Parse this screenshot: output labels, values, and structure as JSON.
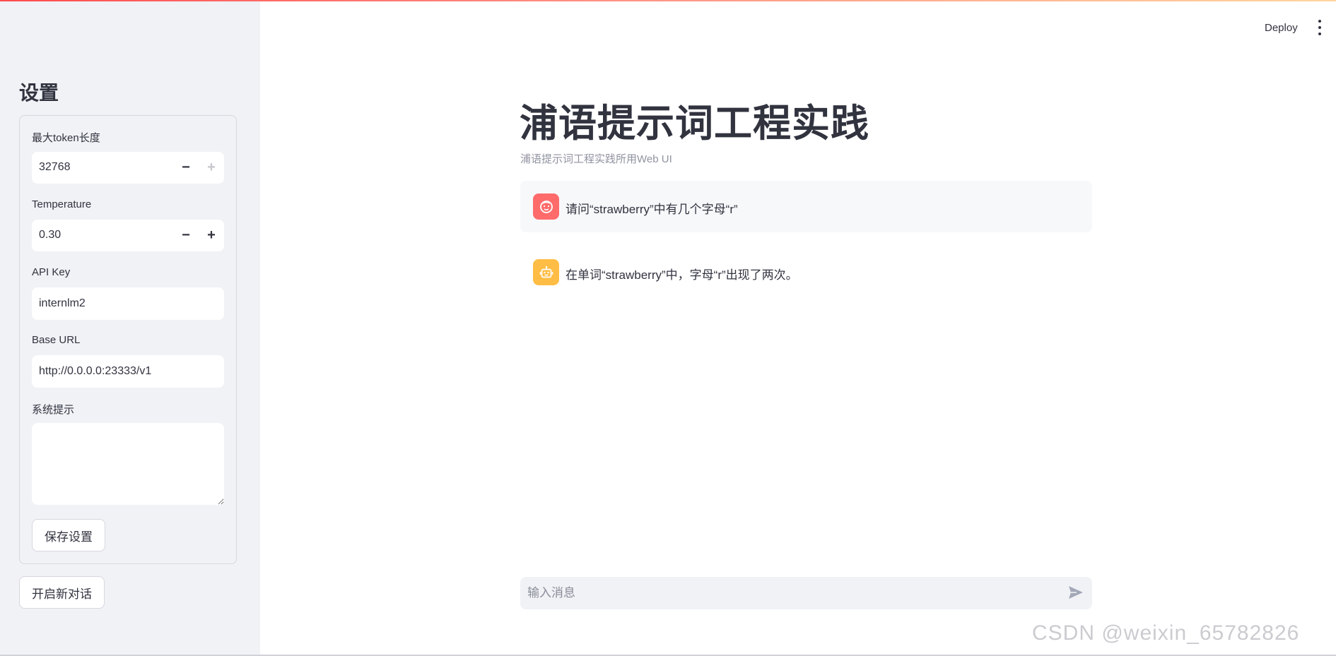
{
  "sidebar": {
    "title": "设置",
    "fields": {
      "max_tokens": {
        "label": "最大token长度",
        "value": "32768"
      },
      "temperature": {
        "label": "Temperature",
        "value": "0.30"
      },
      "api_key": {
        "label": "API Key",
        "value": "internlm2"
      },
      "base_url": {
        "label": "Base URL",
        "value": "http://0.0.0.0:23333/v1"
      },
      "system_prompt": {
        "label": "系统提示",
        "value": ""
      }
    },
    "save_button": "保存设置",
    "new_chat_button": "开启新对话",
    "stepper": {
      "minus": "−",
      "plus": "+"
    }
  },
  "header": {
    "deploy": "Deploy",
    "menu_icon": "vertical-dots-icon"
  },
  "main": {
    "title": "浦语提示词工程实践",
    "subtitle": "浦语提示词工程实践所用Web UI",
    "messages": [
      {
        "role": "user",
        "icon": "face-icon",
        "text": "请问“strawberry”中有几个字母“r”"
      },
      {
        "role": "assistant",
        "icon": "robot-icon",
        "text": "在单词“strawberry”中，字母“r”出现了两次。"
      }
    ],
    "chat_input": {
      "placeholder": "输入消息",
      "send_icon": "send-icon"
    }
  },
  "watermark": "CSDN @weixin_65782826",
  "colors": {
    "sidebar_bg": "#f0f2f6",
    "user_avatar": "#ff6b6b",
    "bot_avatar": "#ffbd45",
    "text": "#31333f"
  }
}
